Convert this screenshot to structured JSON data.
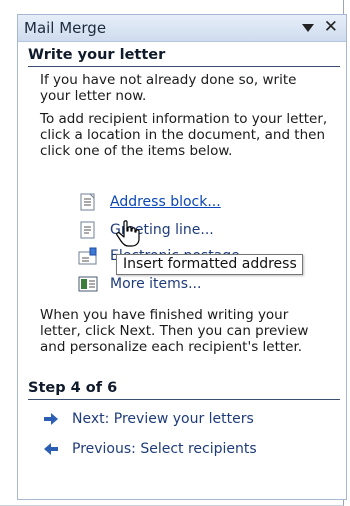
{
  "pane": {
    "title": "Mail Merge"
  },
  "write_section": {
    "heading": "Write your letter",
    "para1": "If you have not already done so, write your letter now.",
    "para2": "To add recipient information to your letter, click a location in the document, and then click one of the items below.",
    "items": [
      {
        "label": "Address block...",
        "icon": "address-block-icon"
      },
      {
        "label": "Greeting line...",
        "icon": "greeting-line-icon"
      },
      {
        "label": "Electronic postage...",
        "icon": "electronic-postage-icon"
      },
      {
        "label": "More items...",
        "icon": "more-items-icon"
      }
    ],
    "para3": "When you have finished writing your letter, click Next. Then you can preview and personalize each recipient's letter."
  },
  "tooltip": {
    "text": "Insert formatted address"
  },
  "step_section": {
    "heading": "Step 4 of 6",
    "next_label": "Next: Preview your letters",
    "previous_label": "Previous: Select recipients"
  },
  "colors": {
    "link": "#0b47b6",
    "pane_border": "#a7b8d3",
    "title_bg": "#dfe8f5",
    "arrow": "#2c5fb4"
  }
}
